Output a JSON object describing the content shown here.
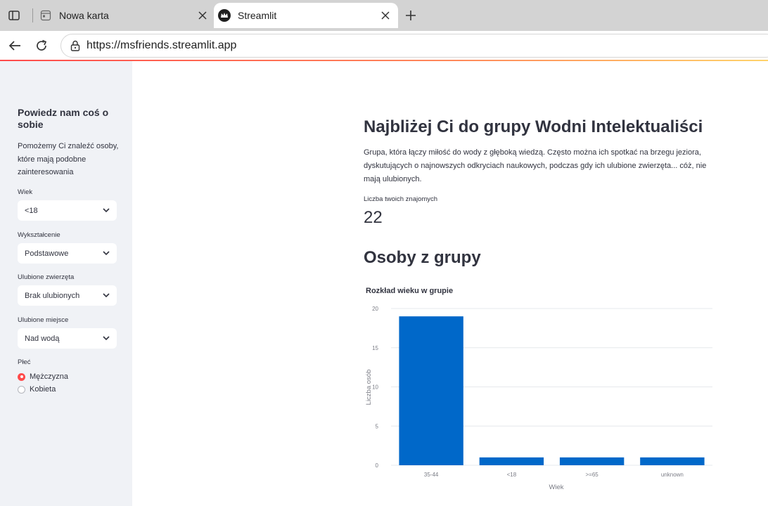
{
  "browser": {
    "tabs": [
      {
        "title": "Nowa karta",
        "active": false
      },
      {
        "title": "Streamlit",
        "active": true
      }
    ],
    "url": "https://msfriends.streamlit.app"
  },
  "sidebar": {
    "title": "Powiedz nam coś o sobie",
    "description": "Pomożemy Ci znaleźć osoby, które mają podobne zainteresowania",
    "fields": [
      {
        "label": "Wiek",
        "value": "<18"
      },
      {
        "label": "Wykształcenie",
        "value": "Podstawowe"
      },
      {
        "label": "Ulubione zwierzęta",
        "value": "Brak ulubionych"
      },
      {
        "label": "Ulubione miejsce",
        "value": "Nad wodą"
      }
    ],
    "gender": {
      "label": "Płeć",
      "options": [
        "Mężczyzna",
        "Kobieta"
      ],
      "selected": "Mężczyzna"
    }
  },
  "main": {
    "heading": "Najbliżej Ci do grupy Wodni Intelektualiści",
    "description": "Grupa, która łączy miłość do wody z głęboką wiedzą. Często można ich spotkać na brzegu jeziora, dyskutujących o najnowszych odkryciach naukowych, podczas gdy ich ulubione zwierzęta... cóż, nie mają ulubionych.",
    "metric": {
      "label": "Liczba twoich znajomych",
      "value": "22"
    },
    "subheading": "Osoby z grupy"
  },
  "chart_data": {
    "type": "bar",
    "title": "Rozkład wieku w grupie",
    "xlabel": "Wiek",
    "ylabel": "Liczba osób",
    "categories": [
      "35-44",
      "<18",
      ">=65",
      "unknown"
    ],
    "values": [
      19,
      1,
      1,
      1
    ],
    "ylim": [
      0,
      20
    ],
    "yticks": [
      0,
      5,
      10,
      15,
      20
    ],
    "grid": true,
    "bar_color": "#0068c9"
  },
  "colors": {
    "accent": "#ff4b4b",
    "sidebar_bg": "#f0f2f6",
    "text": "#31333f"
  }
}
